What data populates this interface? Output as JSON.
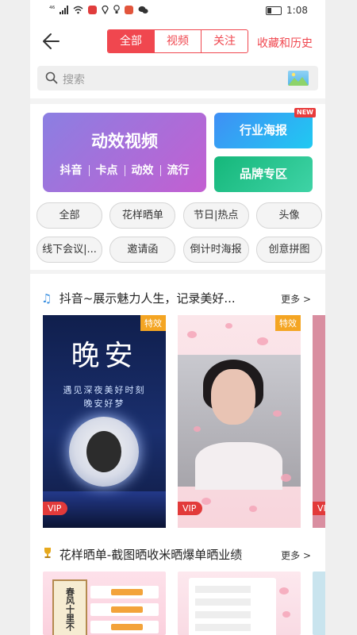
{
  "status_bar": {
    "time": "1:08",
    "carrier": "⁴⁶"
  },
  "header": {
    "back_icon": "back-arrow-icon",
    "tabs": [
      {
        "label": "全部",
        "active": true
      },
      {
        "label": "视频"
      },
      {
        "label": "关注"
      }
    ],
    "history_label": "收藏和历史",
    "accent": "#f0474f"
  },
  "search": {
    "placeholder": "搜索"
  },
  "banners": {
    "main_title": "动效视频",
    "main_tags": [
      "抖音",
      "卡点",
      "动效",
      "流行"
    ],
    "industry_poster": "行业海报",
    "new_badge": "NEW",
    "brand_zone": "品牌专区"
  },
  "categories": {
    "row1": [
      "全部",
      "花样晒单",
      "节日|热点",
      "头像"
    ],
    "row2": [
      "线下会议|...",
      "邀请函",
      "倒计时海报",
      "创意拼图"
    ]
  },
  "section1": {
    "title": "抖音~展示魅力人生，记录美好...",
    "more": "更多 >",
    "cards": [
      {
        "badge": "特效",
        "vip": "VIP",
        "big_text": "晚安",
        "line1": "遇见深夜美好时刻",
        "line2": "晚安好梦"
      },
      {
        "badge": "特效",
        "vip": "VIP"
      }
    ],
    "partial_vip": "VIP"
  },
  "section2": {
    "title": "花样晒单-截图晒收米晒爆单晒业绩",
    "more": "更多 >",
    "scroll_text": "春风十里不"
  }
}
